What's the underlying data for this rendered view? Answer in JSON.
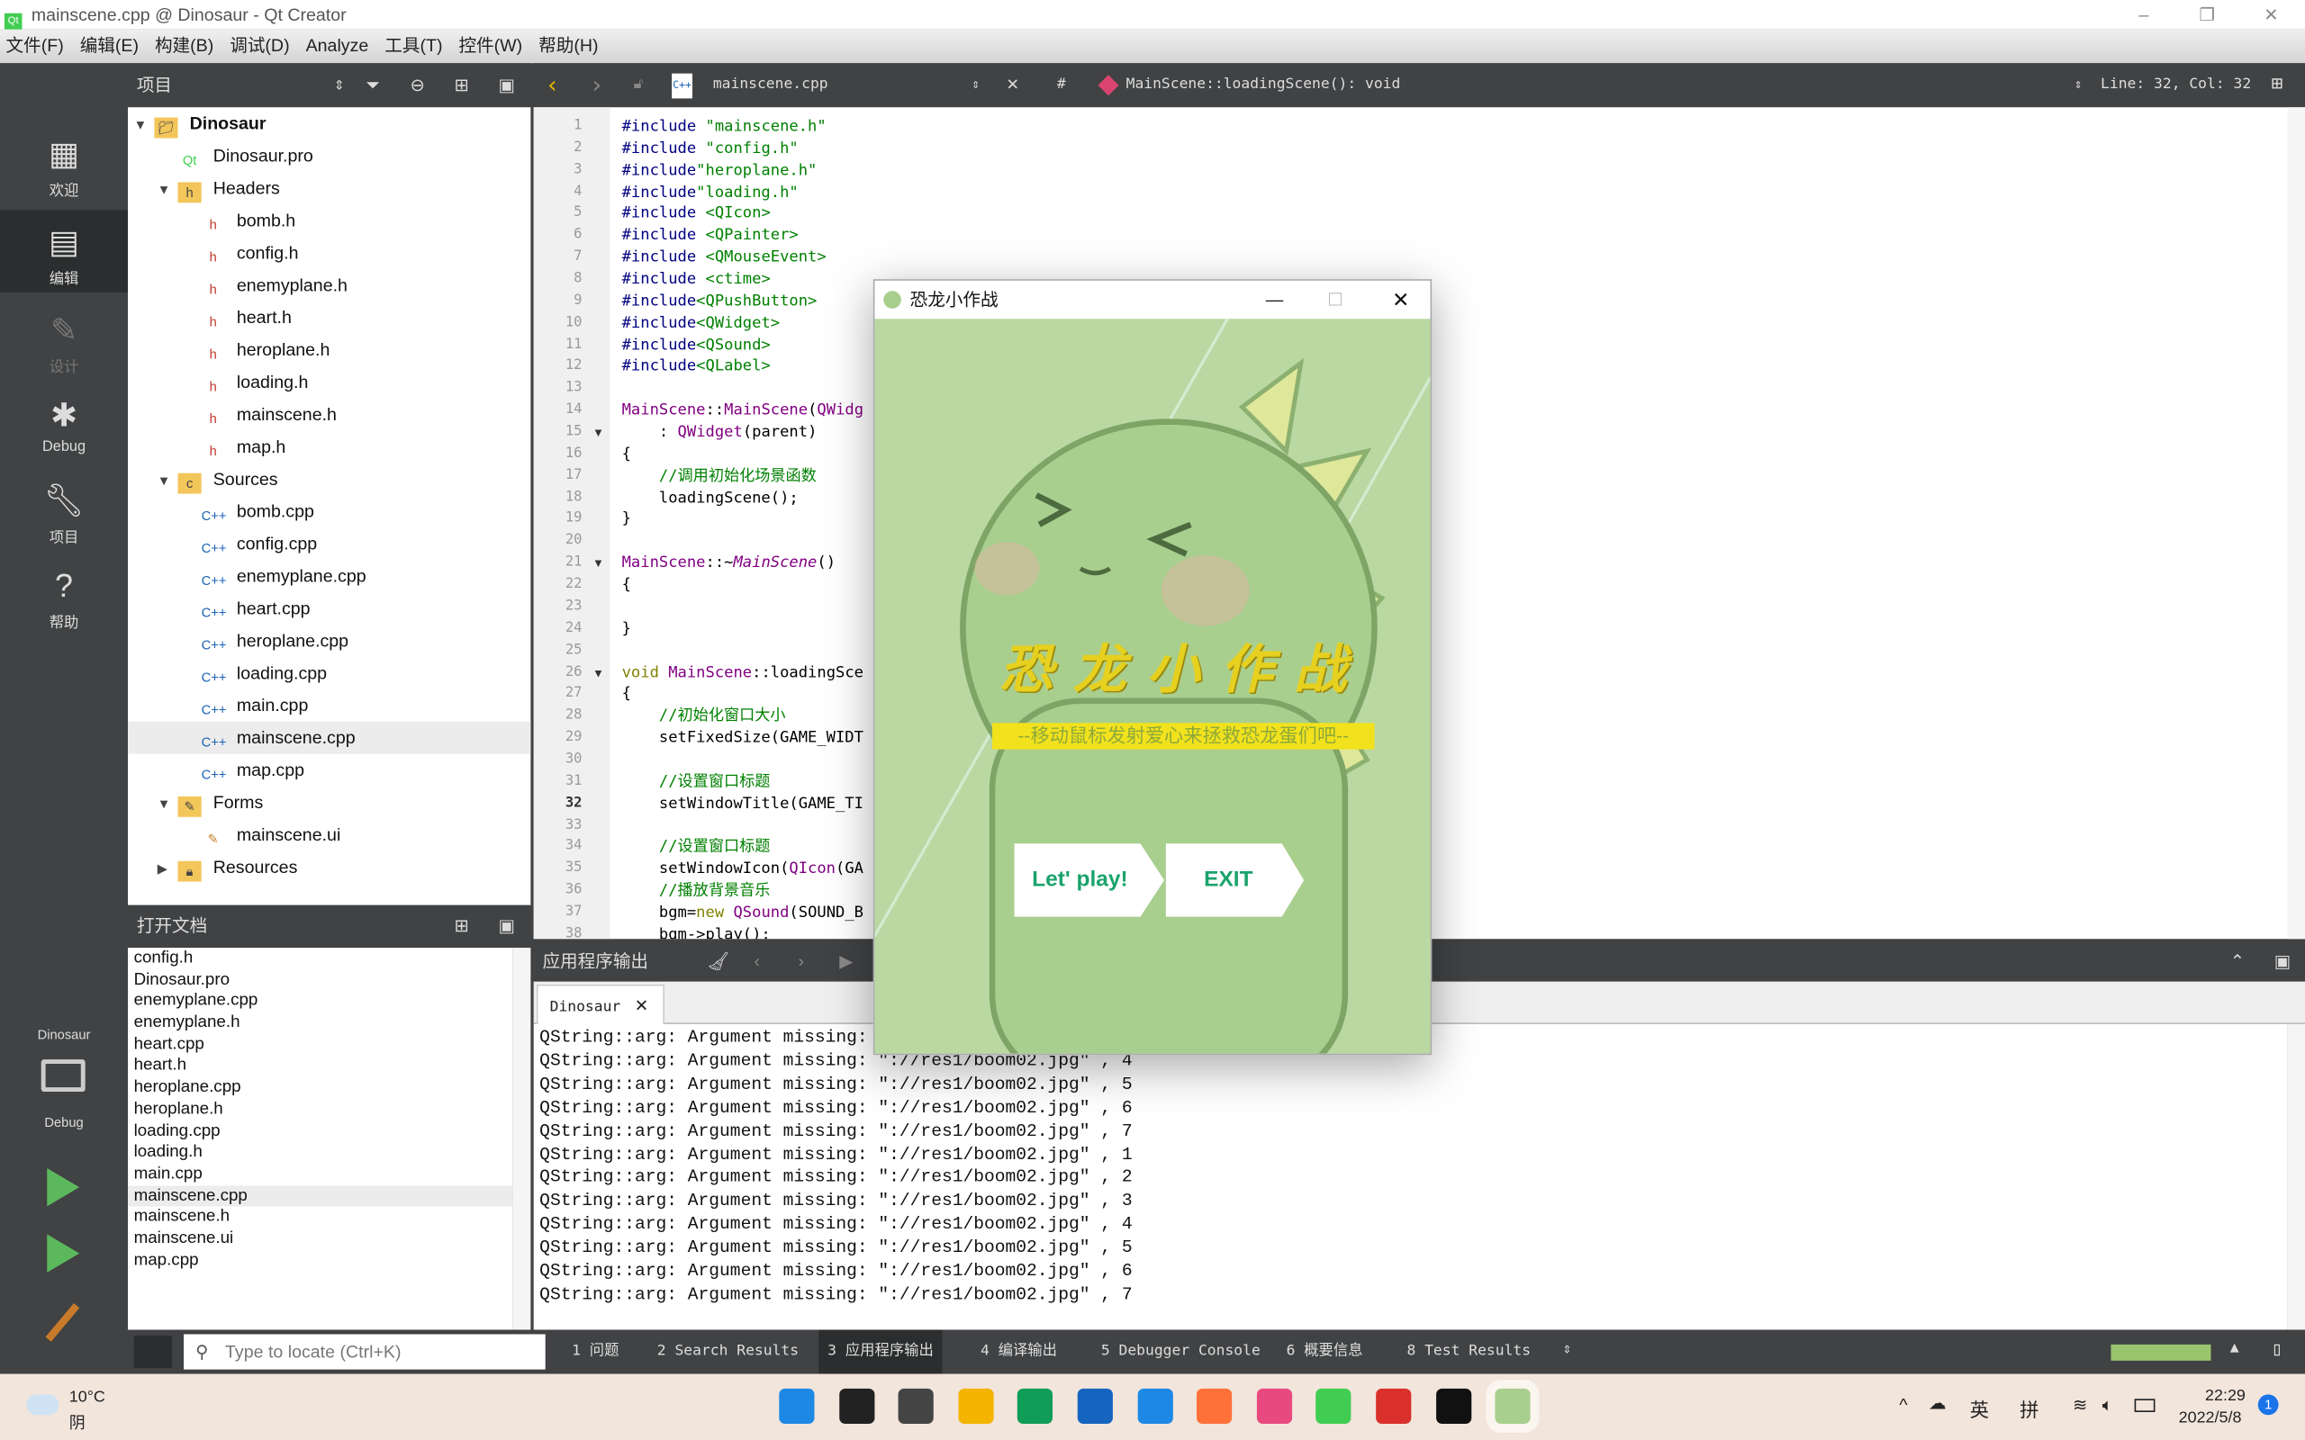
{
  "window": {
    "title": "mainscene.cpp @ Dinosaur - Qt Creator",
    "min": "–",
    "max": "❐",
    "close": "✕"
  },
  "menu": [
    "文件(F)",
    "编辑(E)",
    "构建(B)",
    "调试(D)",
    "Analyze",
    "工具(T)",
    "控件(W)",
    "帮助(H)"
  ],
  "modes": [
    {
      "label": "欢迎",
      "icon": "grid-icon"
    },
    {
      "label": "编辑",
      "icon": "edit-document-icon",
      "active": true
    },
    {
      "label": "设计",
      "icon": "pencil-icon",
      "disabled": true
    },
    {
      "label": "Debug",
      "icon": "bug-icon"
    },
    {
      "label": "项目",
      "icon": "wrench-icon"
    },
    {
      "label": "帮助",
      "icon": "help-icon"
    }
  ],
  "kit": {
    "project": "Dinosaur",
    "config": "Debug"
  },
  "project_panel": {
    "title": "项目"
  },
  "tree": [
    {
      "label": "Dinosaur",
      "depth": 0,
      "type": "project",
      "expanded": true,
      "bold": true
    },
    {
      "label": "Dinosaur.pro",
      "depth": 1,
      "type": "pro"
    },
    {
      "label": "Headers",
      "depth": 1,
      "type": "folder-h",
      "expanded": true
    },
    {
      "label": "bomb.h",
      "depth": 2,
      "type": "h"
    },
    {
      "label": "config.h",
      "depth": 2,
      "type": "h"
    },
    {
      "label": "enemyplane.h",
      "depth": 2,
      "type": "h"
    },
    {
      "label": "heart.h",
      "depth": 2,
      "type": "h"
    },
    {
      "label": "heroplane.h",
      "depth": 2,
      "type": "h"
    },
    {
      "label": "loading.h",
      "depth": 2,
      "type": "h"
    },
    {
      "label": "mainscene.h",
      "depth": 2,
      "type": "h"
    },
    {
      "label": "map.h",
      "depth": 2,
      "type": "h"
    },
    {
      "label": "Sources",
      "depth": 1,
      "type": "folder-cpp",
      "expanded": true
    },
    {
      "label": "bomb.cpp",
      "depth": 2,
      "type": "cpp"
    },
    {
      "label": "config.cpp",
      "depth": 2,
      "type": "cpp"
    },
    {
      "label": "enemyplane.cpp",
      "depth": 2,
      "type": "cpp"
    },
    {
      "label": "heart.cpp",
      "depth": 2,
      "type": "cpp"
    },
    {
      "label": "heroplane.cpp",
      "depth": 2,
      "type": "cpp"
    },
    {
      "label": "loading.cpp",
      "depth": 2,
      "type": "cpp"
    },
    {
      "label": "main.cpp",
      "depth": 2,
      "type": "cpp"
    },
    {
      "label": "mainscene.cpp",
      "depth": 2,
      "type": "cpp",
      "selected": true
    },
    {
      "label": "map.cpp",
      "depth": 2,
      "type": "cpp"
    },
    {
      "label": "Forms",
      "depth": 1,
      "type": "folder-ui",
      "expanded": true
    },
    {
      "label": "mainscene.ui",
      "depth": 2,
      "type": "ui"
    },
    {
      "label": "Resources",
      "depth": 1,
      "type": "folder-res",
      "expanded": false
    }
  ],
  "open_docs": {
    "title": "打开文档",
    "items": [
      "config.h",
      "Dinosaur.pro",
      "enemyplane.cpp",
      "enemyplane.h",
      "heart.cpp",
      "heart.h",
      "heroplane.cpp",
      "heroplane.h",
      "loading.cpp",
      "loading.h",
      "main.cpp",
      "mainscene.cpp",
      "mainscene.h",
      "mainscene.ui",
      "map.cpp"
    ],
    "selected": "mainscene.cpp"
  },
  "editor": {
    "file": "mainscene.cpp",
    "symbol": "MainScene::loadingScene(): void",
    "hash": "#",
    "position": "Line: 32, Col: 32",
    "current_line": 32,
    "folds": [
      15,
      21,
      26
    ],
    "lines": [
      [
        [
          "pp",
          "#include "
        ],
        [
          "str",
          "\"mainscene.h\""
        ]
      ],
      [
        [
          "pp",
          "#include "
        ],
        [
          "str",
          "\"config.h\""
        ]
      ],
      [
        [
          "pp",
          "#include"
        ],
        [
          "str",
          "\"heroplane.h\""
        ]
      ],
      [
        [
          "pp",
          "#include"
        ],
        [
          "str",
          "\"loading.h\""
        ]
      ],
      [
        [
          "pp",
          "#include "
        ],
        [
          "str",
          "<QIcon>"
        ]
      ],
      [
        [
          "pp",
          "#include "
        ],
        [
          "str",
          "<QPainter>"
        ]
      ],
      [
        [
          "pp",
          "#include "
        ],
        [
          "str",
          "<QMouseEvent>"
        ]
      ],
      [
        [
          "pp",
          "#include "
        ],
        [
          "str",
          "<ctime>"
        ]
      ],
      [
        [
          "pp",
          "#include"
        ],
        [
          "str",
          "<QPushButton>"
        ]
      ],
      [
        [
          "pp",
          "#include"
        ],
        [
          "str",
          "<QWidget>"
        ]
      ],
      [
        [
          "pp",
          "#include"
        ],
        [
          "str",
          "<QSound>"
        ]
      ],
      [
        [
          "pp",
          "#include"
        ],
        [
          "str",
          "<QLabel>"
        ]
      ],
      [],
      [
        [
          "cls",
          "MainScene"
        ],
        [
          "n",
          "::"
        ],
        [
          "cls",
          "MainScene"
        ],
        [
          "n",
          "("
        ],
        [
          "cls",
          "QWidg"
        ]
      ],
      [
        [
          "n",
          "    : "
        ],
        [
          "cls",
          "QWidget"
        ],
        [
          "n",
          "(parent)"
        ]
      ],
      [
        [
          "n",
          "{"
        ]
      ],
      [
        [
          "cm",
          "    //调用初始化场景函数"
        ]
      ],
      [
        [
          "n",
          "    loadingScene();"
        ]
      ],
      [
        [
          "n",
          "}"
        ]
      ],
      [],
      [
        [
          "cls",
          "MainScene"
        ],
        [
          "n",
          "::~"
        ],
        [
          "it",
          "MainScene"
        ],
        [
          "n",
          "()"
        ]
      ],
      [
        [
          "n",
          "{"
        ]
      ],
      [],
      [
        [
          "n",
          "}"
        ]
      ],
      [],
      [
        [
          "kw",
          "void "
        ],
        [
          "cls",
          "MainScene"
        ],
        [
          "n",
          "::loadingSce"
        ]
      ],
      [
        [
          "n",
          "{"
        ]
      ],
      [
        [
          "cm",
          "    //初始化窗口大小"
        ]
      ],
      [
        [
          "n",
          "    setFixedSize(GAME_WIDT"
        ]
      ],
      [],
      [
        [
          "cm",
          "    //设置窗口标题"
        ]
      ],
      [
        [
          "n",
          "    setWindowTitle(GAME_TI"
        ]
      ],
      [],
      [
        [
          "cm",
          "    //设置窗口标题"
        ]
      ],
      [
        [
          "n",
          "    setWindowIcon("
        ],
        [
          "cls",
          "QIcon"
        ],
        [
          "n",
          "(GA"
        ]
      ],
      [
        [
          "cm",
          "    //播放背景音乐"
        ]
      ],
      [
        [
          "n",
          "    bgm="
        ],
        [
          "kw",
          "new "
        ],
        [
          "cls",
          "QSound"
        ],
        [
          "n",
          "(SOUND_B"
        ]
      ],
      [
        [
          "n",
          "    bgm->play();"
        ]
      ]
    ]
  },
  "output": {
    "title": "应用程序输出",
    "tab": "Dinosaur",
    "lines": [
      "QString::arg: Argument missing: \"://res1/boom02.jpg\" , 3",
      "QString::arg: Argument missing: \"://res1/boom02.jpg\" , 4",
      "QString::arg: Argument missing: \"://res1/boom02.jpg\" , 5",
      "QString::arg: Argument missing: \"://res1/boom02.jpg\" , 6",
      "QString::arg: Argument missing: \"://res1/boom02.jpg\" , 7",
      "QString::arg: Argument missing: \"://res1/boom02.jpg\" , 1",
      "QString::arg: Argument missing: \"://res1/boom02.jpg\" , 2",
      "QString::arg: Argument missing: \"://res1/boom02.jpg\" , 3",
      "QString::arg: Argument missing: \"://res1/boom02.jpg\" , 4",
      "QString::arg: Argument missing: \"://res1/boom02.jpg\" , 5",
      "QString::arg: Argument missing: \"://res1/boom02.jpg\" , 6",
      "QString::arg: Argument missing: \"://res1/boom02.jpg\" , 7"
    ]
  },
  "statusbar": {
    "locator_placeholder": "Type to locate (Ctrl+K)",
    "tabs": [
      "1  问题",
      "2  Search Results",
      "3  应用程序输出",
      "4  编译输出",
      "5  Debugger Console",
      "6  概要信息",
      "8  Test Results"
    ],
    "active_tab": 2,
    "progress": 1.0,
    "progress_color": "#9ac46e"
  },
  "game": {
    "title": "恐龙小作战",
    "heading": "恐龙小作战",
    "subtitle": "--移动鼠标发射爱心来拯救恐龙蛋们吧--",
    "play_label": "Let' play!",
    "exit_label": "EXIT",
    "bg_color": "#b9d8a2",
    "button_text_color": "#1aa36b"
  },
  "taskbar": {
    "weather_temp": "10°C",
    "weather_desc": "阴",
    "ime_lang": "英",
    "ime_mode": "拼",
    "time": "22:29",
    "date": "2022/5/8",
    "notifications": "1",
    "apps": [
      "start-icon",
      "search-icon",
      "task-view-icon",
      "file-explorer-icon",
      "edge-icon",
      "mail-icon",
      "ie-icon",
      "firefox-icon",
      "app-store-icon",
      "qt-creator-icon",
      "wps-icon",
      "capcut-icon",
      "dinosaur-game-icon"
    ]
  }
}
